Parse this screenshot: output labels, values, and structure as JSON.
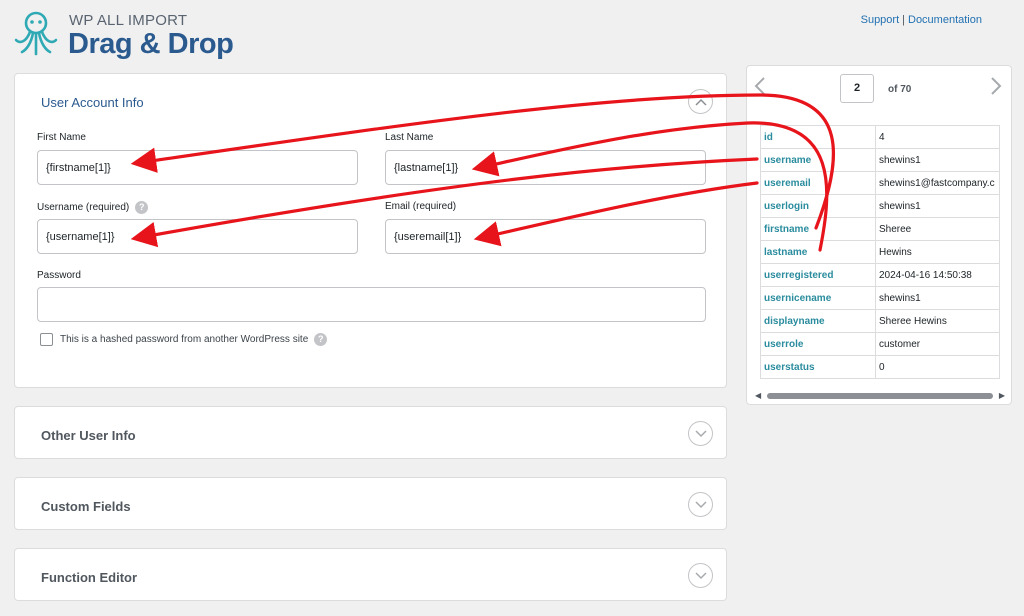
{
  "header": {
    "brand_small": "WP ALL IMPORT",
    "brand_big": "Drag & Drop",
    "support_link": "Support",
    "separator": "|",
    "documentation_link": "Documentation"
  },
  "user_account": {
    "title": "User Account Info",
    "first_name_label": "First Name",
    "first_name_value": "{firstname[1]}",
    "last_name_label": "Last Name",
    "last_name_value": "{lastname[1]}",
    "username_label": "Username (required)",
    "username_value": "{username[1]}",
    "email_label": "Email (required)",
    "email_value": "{useremail[1]}",
    "password_label": "Password",
    "password_value": "",
    "hashed_label": "This is a hashed password from another WordPress site"
  },
  "sections": {
    "other": "Other User Info",
    "custom": "Custom Fields",
    "function": "Function Editor"
  },
  "preview": {
    "page": "2",
    "of": "of 70",
    "rows": [
      {
        "key": "id",
        "value": "4"
      },
      {
        "key": "username",
        "value": "shewins1"
      },
      {
        "key": "useremail",
        "value": "shewins1@fastcompany.c"
      },
      {
        "key": "userlogin",
        "value": "shewins1"
      },
      {
        "key": "firstname",
        "value": "Sheree"
      },
      {
        "key": "lastname",
        "value": "Hewins"
      },
      {
        "key": "userregistered",
        "value": "2024-04-16 14:50:38"
      },
      {
        "key": "usernicename",
        "value": "shewins1"
      },
      {
        "key": "displayname",
        "value": "Sheree Hewins"
      },
      {
        "key": "userrole",
        "value": "customer"
      },
      {
        "key": "userstatus",
        "value": "0"
      }
    ]
  },
  "colors": {
    "accent": "#2b5a8f",
    "field_key": "#2a8c9e",
    "arrow": "#e8141b",
    "logo": "#2fa9b4"
  },
  "icons": {
    "logo": "octopus-logo-icon",
    "chevron_up": "chevron-up-icon",
    "chevron_down": "chevron-down-icon",
    "help": "help-icon",
    "prev": "chevron-left-icon",
    "next": "chevron-right-icon"
  }
}
